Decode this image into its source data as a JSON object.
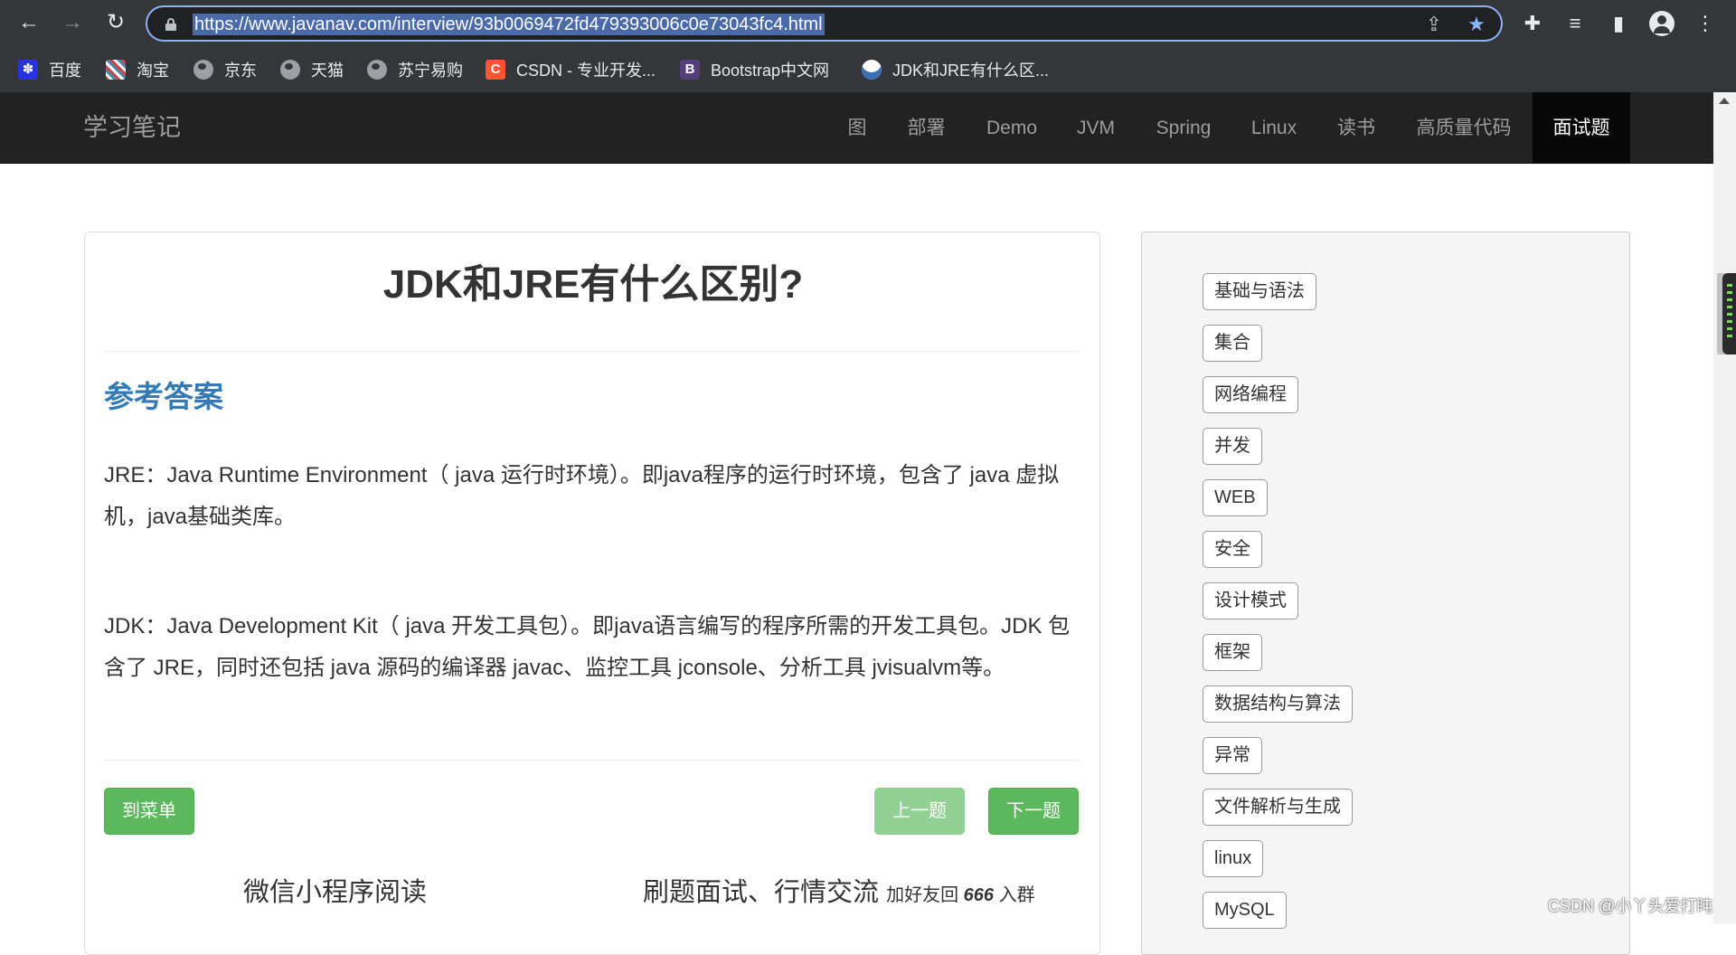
{
  "browser": {
    "url": "https://www.javanav.com/interview/93b0069472fd479393006c0e73043fc4.html",
    "bookmarks": [
      {
        "label": "百度",
        "icon": "baidu-paw-icon"
      },
      {
        "label": "淘宝",
        "icon": "taobao-icon"
      },
      {
        "label": "京东",
        "icon": "globe-icon"
      },
      {
        "label": "天猫",
        "icon": "globe-icon"
      },
      {
        "label": "苏宁易购",
        "icon": "globe-icon"
      },
      {
        "label": "CSDN - 专业开发...",
        "icon": "csdn-icon",
        "glyph": "C",
        "color": "#fc5531"
      },
      {
        "label": "Bootstrap中文网",
        "icon": "bootstrap-icon",
        "glyph": "B",
        "color": "#563d7c"
      },
      {
        "label": "JDK和JRE有什么区...",
        "icon": "avatar-favicon-icon"
      }
    ]
  },
  "navbar": {
    "brand": "学习笔记",
    "items": [
      "图",
      "部署",
      "Demo",
      "JVM",
      "Spring",
      "Linux",
      "读书",
      "高质量代码",
      "面试题"
    ],
    "active_item": "面试题"
  },
  "question": {
    "title": "JDK和JRE有什么区别?",
    "answer_heading": "参考答案",
    "paragraph_1": "JRE：Java Runtime Environment（ java 运行时环境）。即java程序的运行时环境，包含了 java 虚拟机，java基础类库。",
    "paragraph_2": "JDK：Java Development Kit（ java 开发工具包）。即java语言编写的程序所需的开发工具包。JDK 包含了 JRE，同时还包括 java 源码的编译器 javac、监控工具 jconsole、分析工具 jvisualvm等。"
  },
  "buttons": {
    "menu": "到菜单",
    "prev": "上一题",
    "next": "下一题"
  },
  "footer": {
    "mini_program": "微信小程序阅读",
    "community": "刷题面试、行情交流",
    "add_friend_prefix": "加好友回",
    "add_friend_code": "666",
    "add_friend_suffix": "入群"
  },
  "sidebar": {
    "tags": [
      "基础与语法",
      "集合",
      "网络编程",
      "并发",
      "WEB",
      "安全",
      "设计模式",
      "框架",
      "数据结构与算法",
      "异常",
      "文件解析与生成",
      "linux",
      "MySQL"
    ]
  },
  "watermark": "CSDN @小丫头爱打盹",
  "colors": {
    "chrome": "#35363a",
    "navbar": "#222222",
    "link_blue": "#337ab7",
    "button_green": "#5cb85c",
    "omnibox_focus": "#8ab4f8"
  }
}
